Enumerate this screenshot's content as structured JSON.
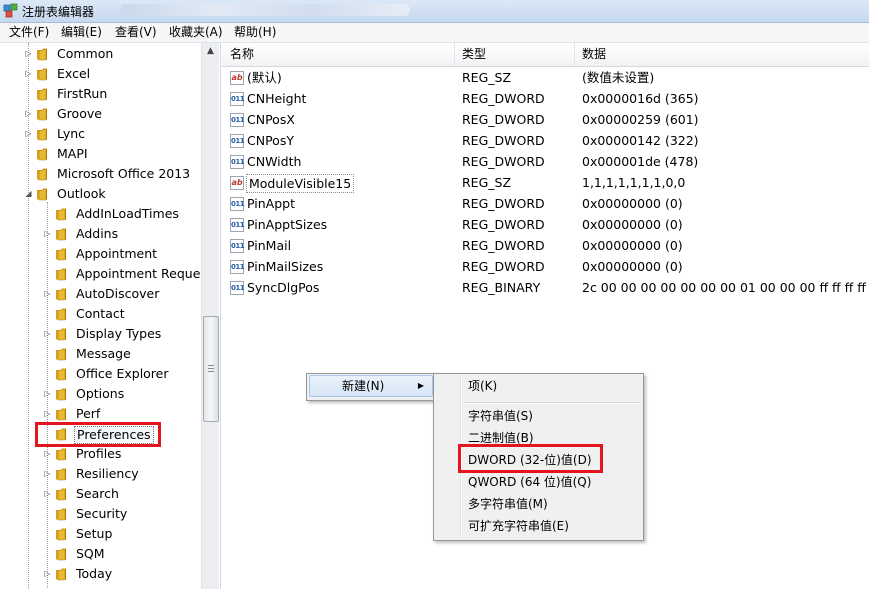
{
  "window": {
    "title": "注册表编辑器"
  },
  "menubar": {
    "items": [
      "文件(F)",
      "编辑(E)",
      "查看(V)",
      "收藏夹(A)",
      "帮助(H)"
    ]
  },
  "tree": {
    "items": [
      {
        "label": "Common",
        "expandable": true
      },
      {
        "label": "Excel",
        "expandable": true
      },
      {
        "label": "FirstRun",
        "expandable": false
      },
      {
        "label": "Groove",
        "expandable": true
      },
      {
        "label": "Lync",
        "expandable": true
      },
      {
        "label": "MAPI",
        "expandable": false
      },
      {
        "label": "Microsoft Office 2013",
        "expandable": false
      },
      {
        "label": "Outlook",
        "expandable": true,
        "expanded": true
      },
      {
        "label": "AddInLoadTimes",
        "expandable": false
      },
      {
        "label": "Addins",
        "expandable": true
      },
      {
        "label": "Appointment",
        "expandable": false
      },
      {
        "label": "Appointment Reques",
        "expandable": false
      },
      {
        "label": "AutoDiscover",
        "expandable": true
      },
      {
        "label": "Contact",
        "expandable": false
      },
      {
        "label": "Display Types",
        "expandable": true
      },
      {
        "label": "Message",
        "expandable": false
      },
      {
        "label": "Office Explorer",
        "expandable": false
      },
      {
        "label": "Options",
        "expandable": true
      },
      {
        "label": "Perf",
        "expandable": true
      },
      {
        "label": "Preferences",
        "expandable": false,
        "selected": true
      },
      {
        "label": "Profiles",
        "expandable": true
      },
      {
        "label": "Resiliency",
        "expandable": true
      },
      {
        "label": "Search",
        "expandable": true
      },
      {
        "label": "Security",
        "expandable": false
      },
      {
        "label": "Setup",
        "expandable": false
      },
      {
        "label": "SQM",
        "expandable": false
      },
      {
        "label": "Today",
        "expandable": true
      }
    ]
  },
  "list": {
    "columns": [
      "名称",
      "类型",
      "数据"
    ],
    "rows": [
      {
        "icon": "string-value-icon",
        "name": "(默认)",
        "type": "REG_SZ",
        "data": "(数值未设置)"
      },
      {
        "icon": "binary-value-icon",
        "name": "CNHeight",
        "type": "REG_DWORD",
        "data": "0x0000016d (365)"
      },
      {
        "icon": "binary-value-icon",
        "name": "CNPosX",
        "type": "REG_DWORD",
        "data": "0x00000259 (601)"
      },
      {
        "icon": "binary-value-icon",
        "name": "CNPosY",
        "type": "REG_DWORD",
        "data": "0x00000142 (322)"
      },
      {
        "icon": "binary-value-icon",
        "name": "CNWidth",
        "type": "REG_DWORD",
        "data": "0x000001de (478)"
      },
      {
        "icon": "string-value-icon",
        "name": "ModuleVisible15",
        "type": "REG_SZ",
        "data": "1,1,1,1,1,1,1,0,0",
        "focused": true
      },
      {
        "icon": "binary-value-icon",
        "name": "PinAppt",
        "type": "REG_DWORD",
        "data": "0x00000000 (0)"
      },
      {
        "icon": "binary-value-icon",
        "name": "PinApptSizes",
        "type": "REG_DWORD",
        "data": "0x00000000 (0)"
      },
      {
        "icon": "binary-value-icon",
        "name": "PinMail",
        "type": "REG_DWORD",
        "data": "0x00000000 (0)"
      },
      {
        "icon": "binary-value-icon",
        "name": "PinMailSizes",
        "type": "REG_DWORD",
        "data": "0x00000000 (0)"
      },
      {
        "icon": "binary-value-icon",
        "name": "SyncDlgPos",
        "type": "REG_BINARY",
        "data": "2c 00 00 00 00 00 00 00 01 00 00 00 ff ff ff ff f..."
      }
    ]
  },
  "context_menu": {
    "new_label": "新建(N)"
  },
  "submenu": {
    "items": [
      "项(K)",
      "字符串值(S)",
      "二进制值(B)",
      "DWORD (32-位)值(D)",
      "QWORD (64 位)值(Q)",
      "多字符串值(M)",
      "可扩充字符串值(E)"
    ]
  },
  "colors": {
    "highlight": "#e3151e",
    "folder": "#e8b830"
  }
}
